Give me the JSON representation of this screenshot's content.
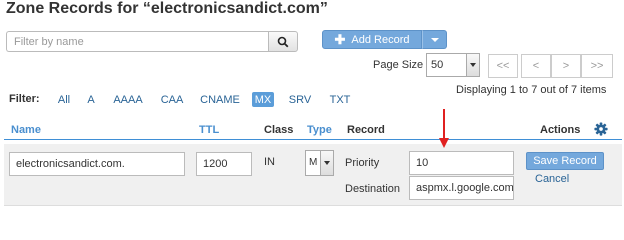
{
  "page": {
    "title": "Zone Records for “electronicsandict.com”"
  },
  "search": {
    "placeholder": "Filter by name",
    "value": ""
  },
  "toolbar": {
    "add_label": "Add Record"
  },
  "pagination": {
    "page_size_label": "Page Size",
    "page_size_value": "50",
    "first": "<<",
    "prev": "<",
    "next": ">",
    "last": ">>",
    "displaying": "Displaying 1 to 7 out of 7 items"
  },
  "filter": {
    "label": "Filter:",
    "options": [
      "All",
      "A",
      "AAAA",
      "CAA",
      "CNAME",
      "MX",
      "SRV",
      "TXT"
    ],
    "active": "MX"
  },
  "table": {
    "headers": {
      "name": "Name",
      "ttl": "TTL",
      "class": "Class",
      "type": "Type",
      "record": "Record",
      "actions": "Actions"
    }
  },
  "edit_row": {
    "name": "electronicsandict.com.",
    "ttl": "1200",
    "class": "IN",
    "type": "M",
    "priority_label": "Priority",
    "priority": "10",
    "destination_label": "Destination",
    "destination": "aspmx.l.google.com",
    "save_label": "Save Record",
    "cancel_label": "Cancel"
  },
  "colors": {
    "accent": "#74a8dc",
    "link": "#2a6496",
    "header_line": "#3f8fd6",
    "annotation": "#e02020"
  },
  "icons": [
    "search-icon",
    "plus-icon",
    "chevron-down-icon",
    "gear-icon",
    "red-arrow-annotation"
  ]
}
